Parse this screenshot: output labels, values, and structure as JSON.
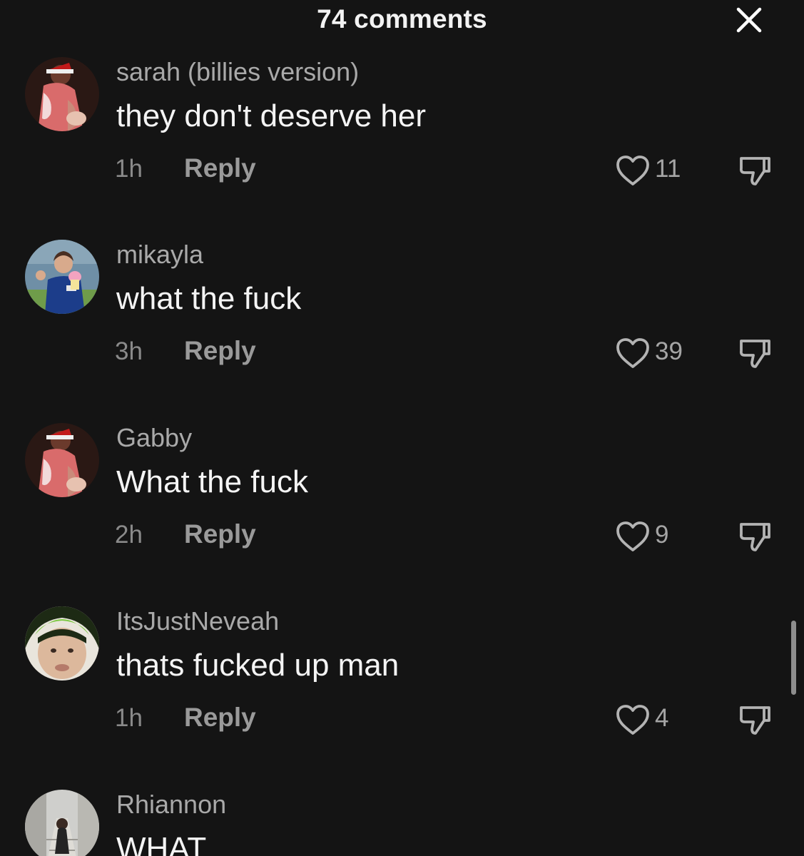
{
  "header": {
    "title": "74 comments",
    "close_icon": "close-icon"
  },
  "comments": [
    {
      "username": "sarah (billies version)",
      "text": "they don't deserve her",
      "time": "1h",
      "reply_label": "Reply",
      "likes": "11",
      "avatar": "avatar-santa-hat"
    },
    {
      "username": "mikayla",
      "text": "what the fuck",
      "time": "3h",
      "reply_label": "Reply",
      "likes": "39",
      "avatar": "avatar-girl-jersey"
    },
    {
      "username": "Gabby",
      "text": "What the fuck",
      "time": "2h",
      "reply_label": "Reply",
      "likes": "9",
      "avatar": "avatar-santa-hat"
    },
    {
      "username": "ItsJustNeveah",
      "text": "thats fucked up man",
      "time": "1h",
      "reply_label": "Reply",
      "likes": "4",
      "avatar": "avatar-green-hair"
    },
    {
      "username": "Rhiannon",
      "text": "WHAT",
      "avatar": "avatar-stairs"
    }
  ],
  "colors": {
    "background": "#141414",
    "username": "#a9a9a9",
    "text": "#f4f4f4",
    "muted": "#8a8a8a"
  }
}
